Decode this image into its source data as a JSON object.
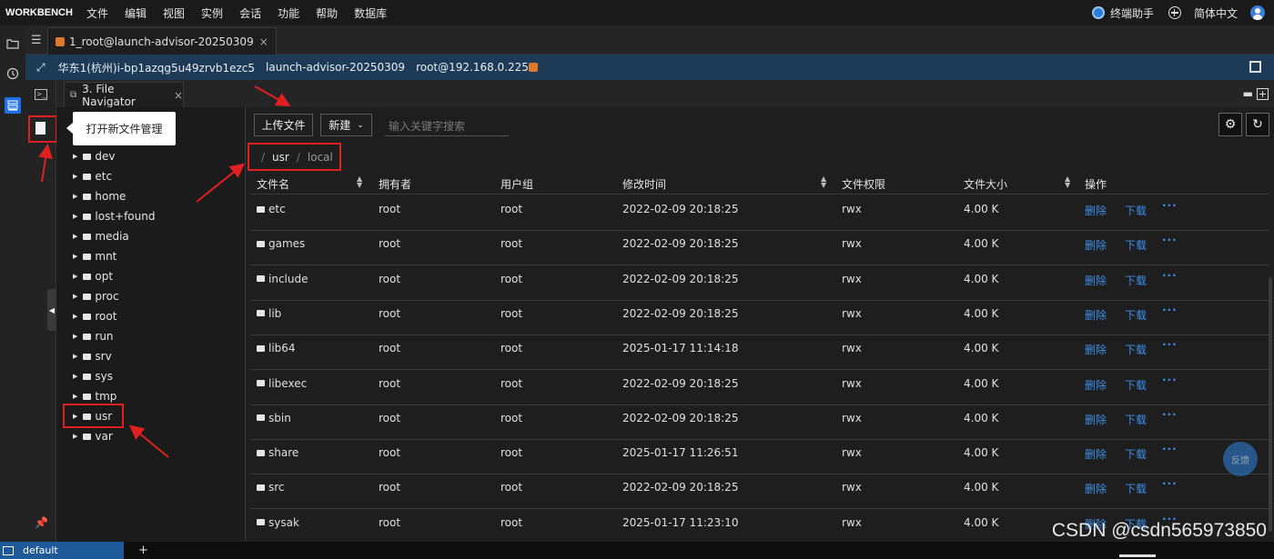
{
  "menubar": {
    "brand": "WORKBENCH",
    "items": [
      "文件",
      "编辑",
      "视图",
      "实例",
      "会话",
      "功能",
      "帮助",
      "数据库"
    ],
    "assistant": "终端助手",
    "language": "简体中文"
  },
  "session_tab": {
    "label": "1_root@launch-advisor-20250309",
    "close": "×"
  },
  "infobar": {
    "region_instance": "华东1(杭州)i-bp1azqg5u49zrvb1ezc5",
    "instance_name": "launch-advisor-20250309",
    "user_host": "root@192.168.0.225"
  },
  "nav_tab": {
    "label": "3. File Navigator",
    "close": "×"
  },
  "tooltip": "打开新文件管理",
  "tree": {
    "items": [
      "dev",
      "etc",
      "home",
      "lost+found",
      "media",
      "mnt",
      "opt",
      "proc",
      "root",
      "run",
      "srv",
      "sys",
      "tmp",
      "usr",
      "var"
    ]
  },
  "toolbar": {
    "upload": "上传文件",
    "new": "新建",
    "search_placeholder": "输入关键字搜索"
  },
  "breadcrumb": {
    "sep": "/",
    "parts": [
      "usr",
      "local"
    ]
  },
  "table": {
    "headers": [
      "文件名",
      "拥有者",
      "用户组",
      "修改时间",
      "文件权限",
      "文件大小",
      "操作"
    ],
    "rows": [
      [
        "etc",
        "root",
        "root",
        "2022-02-09 20:18:25",
        "rwx",
        "4.00 K"
      ],
      [
        "games",
        "root",
        "root",
        "2022-02-09 20:18:25",
        "rwx",
        "4.00 K"
      ],
      [
        "include",
        "root",
        "root",
        "2022-02-09 20:18:25",
        "rwx",
        "4.00 K"
      ],
      [
        "lib",
        "root",
        "root",
        "2022-02-09 20:18:25",
        "rwx",
        "4.00 K"
      ],
      [
        "lib64",
        "root",
        "root",
        "2025-01-17 11:14:18",
        "rwx",
        "4.00 K"
      ],
      [
        "libexec",
        "root",
        "root",
        "2022-02-09 20:18:25",
        "rwx",
        "4.00 K"
      ],
      [
        "sbin",
        "root",
        "root",
        "2022-02-09 20:18:25",
        "rwx",
        "4.00 K"
      ],
      [
        "share",
        "root",
        "root",
        "2025-01-17 11:26:51",
        "rwx",
        "4.00 K"
      ],
      [
        "src",
        "root",
        "root",
        "2022-02-09 20:18:25",
        "rwx",
        "4.00 K"
      ],
      [
        "sysak",
        "root",
        "root",
        "2025-01-17 11:23:10",
        "rwx",
        "4.00 K"
      ]
    ],
    "action_delete": "删除",
    "action_download": "下载",
    "action_more": "···"
  },
  "feedback": "反馈",
  "statusbar": {
    "session": "default",
    "plus": "+"
  },
  "watermark": "CSDN @csdn565973850",
  "colors": {
    "accent": "#1f6feb",
    "link": "#3d8fe8",
    "annotation": "#e02020",
    "infobar": "#1d3a56"
  }
}
